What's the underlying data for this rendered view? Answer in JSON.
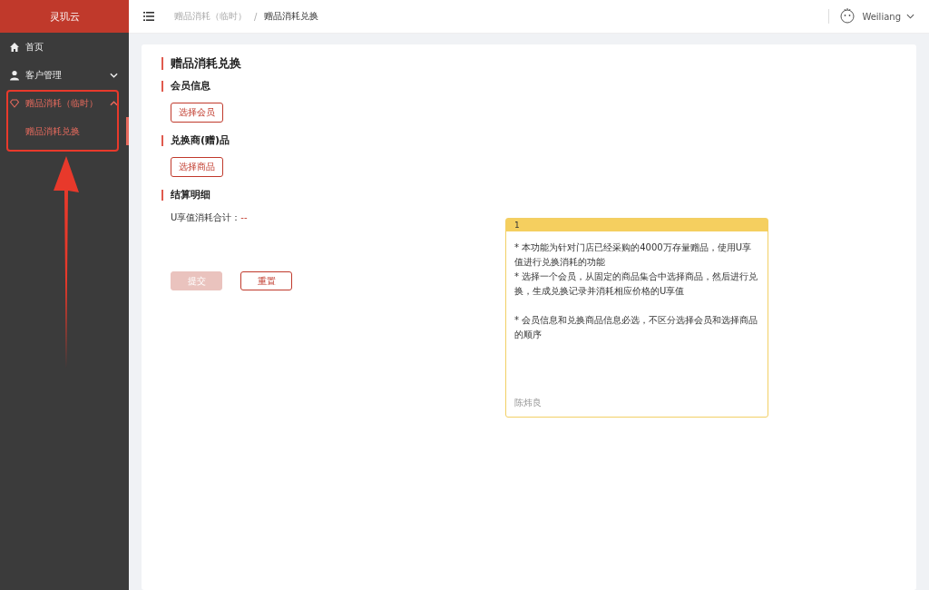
{
  "sidebar": {
    "logo": "灵玑云",
    "items": [
      {
        "label": "首页",
        "kind": "home",
        "selected": false
      },
      {
        "label": "客户管理",
        "kind": "user",
        "expanded": false,
        "selected": false
      },
      {
        "label": "赠品消耗（临时）",
        "kind": "gift",
        "expanded": true,
        "selected": true,
        "children": [
          {
            "label": "赠品消耗兑换",
            "selected": true
          }
        ]
      }
    ]
  },
  "header": {
    "breadcrumb": [
      {
        "label": "赠品消耗（临时）",
        "current": false
      },
      {
        "label": "赠品消耗兑换",
        "current": true
      }
    ],
    "separator": "/",
    "user": "Weiliang"
  },
  "page": {
    "title": "赠品消耗兑换",
    "sections": [
      {
        "title": "会员信息",
        "button": "选择会员"
      },
      {
        "title": "兑换商(赠)品",
        "button": "选择商品"
      },
      {
        "title": "结算明细",
        "summary_label": "U享值消耗合计：",
        "summary_value": "--"
      }
    ],
    "actions": [
      {
        "label": "提交",
        "disabled": true
      },
      {
        "label": "重置",
        "disabled": false
      }
    ]
  },
  "note": {
    "number": "1",
    "paragraphs": [
      [
        "* 本功能为针对门店已经采购的4000万存量赠品，使用U享值进行兑换消耗的功能",
        "* 选择一个会员，从固定的商品集合中选择商品，然后进行兑换，生成兑换记录并消耗相应价格的U享值"
      ],
      [
        "* 会员信息和兑换商品信息必选，不区分选择会员和选择商品的顺序"
      ]
    ],
    "author": "陈炜良"
  }
}
